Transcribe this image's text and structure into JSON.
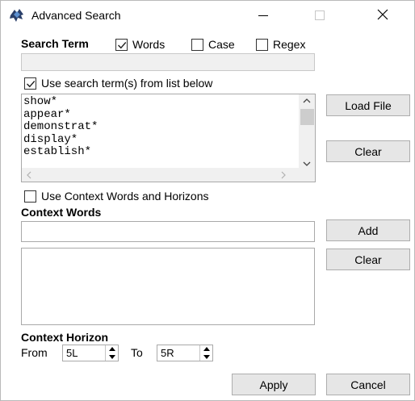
{
  "window": {
    "title": "Advanced Search"
  },
  "search_term": {
    "label": "Search Term",
    "words": {
      "label": "Words",
      "checked": true
    },
    "case": {
      "label": "Case",
      "checked": false
    },
    "regex": {
      "label": "Regex",
      "checked": false
    },
    "value": ""
  },
  "list_option": {
    "label": "Use search term(s) from list below",
    "checked": true
  },
  "term_list": {
    "items": [
      "show*",
      "appear*",
      "demonstrat*",
      "display*",
      "establish*"
    ]
  },
  "buttons": {
    "load_file": "Load File",
    "clear_terms": "Clear",
    "add": "Add",
    "clear_context": "Clear",
    "apply": "Apply",
    "cancel": "Cancel"
  },
  "context_option": {
    "label": "Use Context Words and Horizons",
    "checked": false
  },
  "context_words": {
    "label": "Context Words",
    "value": ""
  },
  "context_horizon": {
    "label": "Context Horizon",
    "from_label": "From",
    "from_value": "5L",
    "to_label": "To",
    "to_value": "5R"
  },
  "icons": {
    "app": "app-icon",
    "minimize": "minimize-icon",
    "maximize": "maximize-icon",
    "close": "close-icon",
    "checkmark": "checkmark-icon"
  }
}
